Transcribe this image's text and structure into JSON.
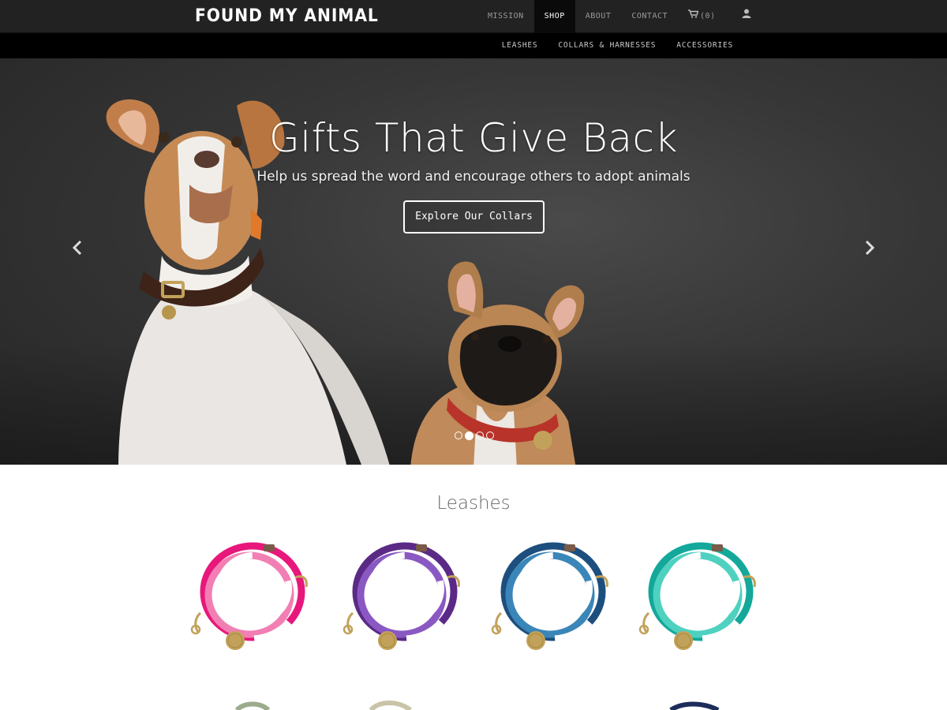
{
  "header": {
    "brand": "FOUND MY ANIMAL",
    "nav": [
      {
        "label": "MISSION",
        "active": false
      },
      {
        "label": "SHOP",
        "active": true
      },
      {
        "label": "ABOUT",
        "active": false
      },
      {
        "label": "CONTACT",
        "active": false
      }
    ],
    "cart_count": "(0)",
    "cart_icon": "cart-icon",
    "user_icon": "user-icon"
  },
  "subnav": {
    "items": [
      "LEASHES",
      "COLLARS & HARNESSES",
      "ACCESSORIES"
    ]
  },
  "hero": {
    "title": "Gifts That Give Back",
    "subtitle": "Help us spread the word and encourage others to adopt animals",
    "button": "Explore Our Collars",
    "slide_count": 4,
    "active_slide": 2
  },
  "leashes": {
    "title": "Leashes",
    "products": [
      {
        "name": "pink-ombre-leash",
        "colors": [
          "#e8177b",
          "#f27fb3",
          "#ffffff"
        ]
      },
      {
        "name": "purple-ombre-leash",
        "colors": [
          "#5b2a86",
          "#8a58c2",
          "#ffffff"
        ]
      },
      {
        "name": "blue-ombre-leash",
        "colors": [
          "#1d4f7e",
          "#3b86b8",
          "#ffffff"
        ]
      },
      {
        "name": "teal-ombre-leash",
        "colors": [
          "#13a89a",
          "#4fd1c0",
          "#ffffff"
        ]
      }
    ]
  },
  "colors": {
    "topbar": "#222222",
    "subbar": "#000000",
    "brass": "#c2a25a"
  }
}
